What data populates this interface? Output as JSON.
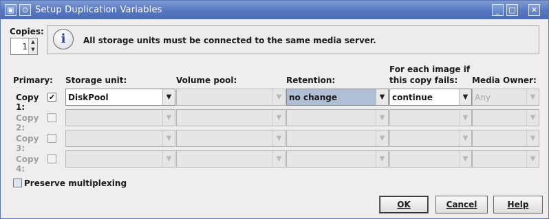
{
  "window": {
    "title": "Setup Duplication Variables"
  },
  "copies": {
    "label": "Copies:",
    "value": "1"
  },
  "info": {
    "message": "All storage units must be connected to the same media server."
  },
  "headers": {
    "primary": "Primary:",
    "storage_unit": "Storage unit:",
    "volume_pool": "Volume pool:",
    "retention": "Retention:",
    "fail_line1": "For each image if",
    "fail_line2": "this copy fails:",
    "media_owner": "Media Owner:"
  },
  "rows": [
    {
      "label": "Copy 1:",
      "checked": "✔",
      "storage_unit": "DiskPool",
      "volume_pool": "",
      "retention": "no change",
      "on_fail": "continue",
      "media_owner": "Any"
    },
    {
      "label": "Copy 2:",
      "checked": "",
      "storage_unit": "",
      "volume_pool": "",
      "retention": "",
      "on_fail": "",
      "media_owner": ""
    },
    {
      "label": "Copy 3:",
      "checked": "",
      "storage_unit": "",
      "volume_pool": "",
      "retention": "",
      "on_fail": "",
      "media_owner": ""
    },
    {
      "label": "Copy 4:",
      "checked": "",
      "storage_unit": "",
      "volume_pool": "",
      "retention": "",
      "on_fail": "",
      "media_owner": ""
    }
  ],
  "preserve_multiplexing": {
    "label": "Preserve multiplexing",
    "checked": false
  },
  "buttons": {
    "ok": "OK",
    "cancel": "Cancel",
    "help": "Help"
  }
}
